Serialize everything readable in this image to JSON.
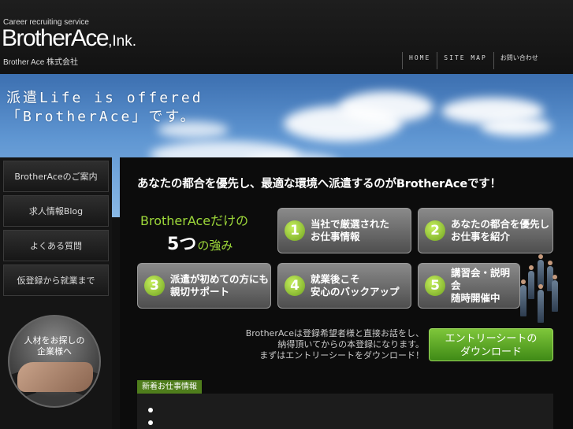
{
  "header": {
    "tagline": "Career recruiting service",
    "logo_main": "BrotherAce",
    "logo_ink": ",Ink.",
    "company": "Brother Ace 株式会社",
    "nav": [
      {
        "label": "HOME"
      },
      {
        "label": "SITE MAP"
      },
      {
        "label": "お問い合わせ"
      }
    ]
  },
  "hero": {
    "line1": "派遣Life is offered",
    "line2": "「BrotherAce」です。"
  },
  "sidebar": {
    "items": [
      {
        "label": "BrotherAceのご案内"
      },
      {
        "label": "求人情報Blog"
      },
      {
        "label": "よくある質問"
      },
      {
        "label": "仮登録から就業まで"
      }
    ],
    "circle_line1": "人材をお探しの",
    "circle_line2": "企業様へ"
  },
  "main": {
    "headline": "あなたの都合を優先し、最適な環境へ派遣するのがBrotherAceです！",
    "strength_title": "BrotherAceだけの",
    "strength_num": "5つ",
    "strength_suffix": "の強み",
    "cards": [
      {
        "num": "1",
        "line1": "当社で厳選された",
        "line2": "お仕事情報"
      },
      {
        "num": "2",
        "line1": "あなたの都合を優先し",
        "line2": "お仕事を紹介"
      },
      {
        "num": "3",
        "line1": "派遣が初めての方にも",
        "line2": "親切サポート"
      },
      {
        "num": "4",
        "line1": "就業後こそ",
        "line2": "安心のバックアップ"
      },
      {
        "num": "5",
        "line1": "講習会・説明会",
        "line2": "随時開催中"
      }
    ],
    "entry_text": [
      "BrotherAceは登録希望者様と直接お話をし、",
      "納得頂いてからの本登録になります。",
      "まずはエントリーシートをダウンロード！"
    ],
    "entry_button_line1": "エントリーシートの",
    "entry_button_line2": "ダウンロード",
    "news_label": "新着お仕事情報"
  }
}
